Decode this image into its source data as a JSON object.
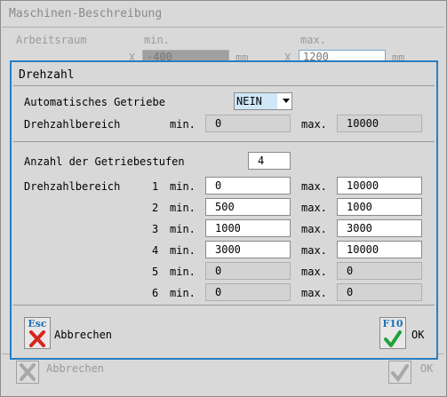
{
  "background": {
    "title": "Maschinen-Beschreibung",
    "section_label": "Arbeitsraum",
    "min_header": "min.",
    "max_header": "max.",
    "axis": "X",
    "min_value": "-400",
    "max_value": "1200",
    "unit": "mm",
    "cancel_label": "Abbrechen",
    "ok_label": "OK"
  },
  "dialog": {
    "title": "Drehzahl",
    "auto_gear_label": "Automatisches Getriebe",
    "auto_gear_value": "NEIN",
    "range_label": "Drehzahlbereich",
    "min_label": "min.",
    "max_label": "max.",
    "overall_min": "0",
    "overall_max": "10000",
    "gear_count_label": "Anzahl der Getriebestufen",
    "gear_count": "4",
    "gears": [
      {
        "num": "1",
        "min": "0",
        "max": "10000",
        "editable": true
      },
      {
        "num": "2",
        "min": "500",
        "max": "1000",
        "editable": true
      },
      {
        "num": "3",
        "min": "1000",
        "max": "3000",
        "editable": true
      },
      {
        "num": "4",
        "min": "3000",
        "max": "10000",
        "editable": true
      },
      {
        "num": "5",
        "min": "0",
        "max": "0",
        "editable": false
      },
      {
        "num": "6",
        "min": "0",
        "max": "0",
        "editable": false
      }
    ],
    "cancel": {
      "key": "Esc",
      "label": "Abbrechen"
    },
    "ok": {
      "key": "F10",
      "label": "OK"
    }
  },
  "colors": {
    "accent": "#2a7ec2",
    "cancel_icon": "#d8251c",
    "ok_icon": "#1fa13b"
  }
}
